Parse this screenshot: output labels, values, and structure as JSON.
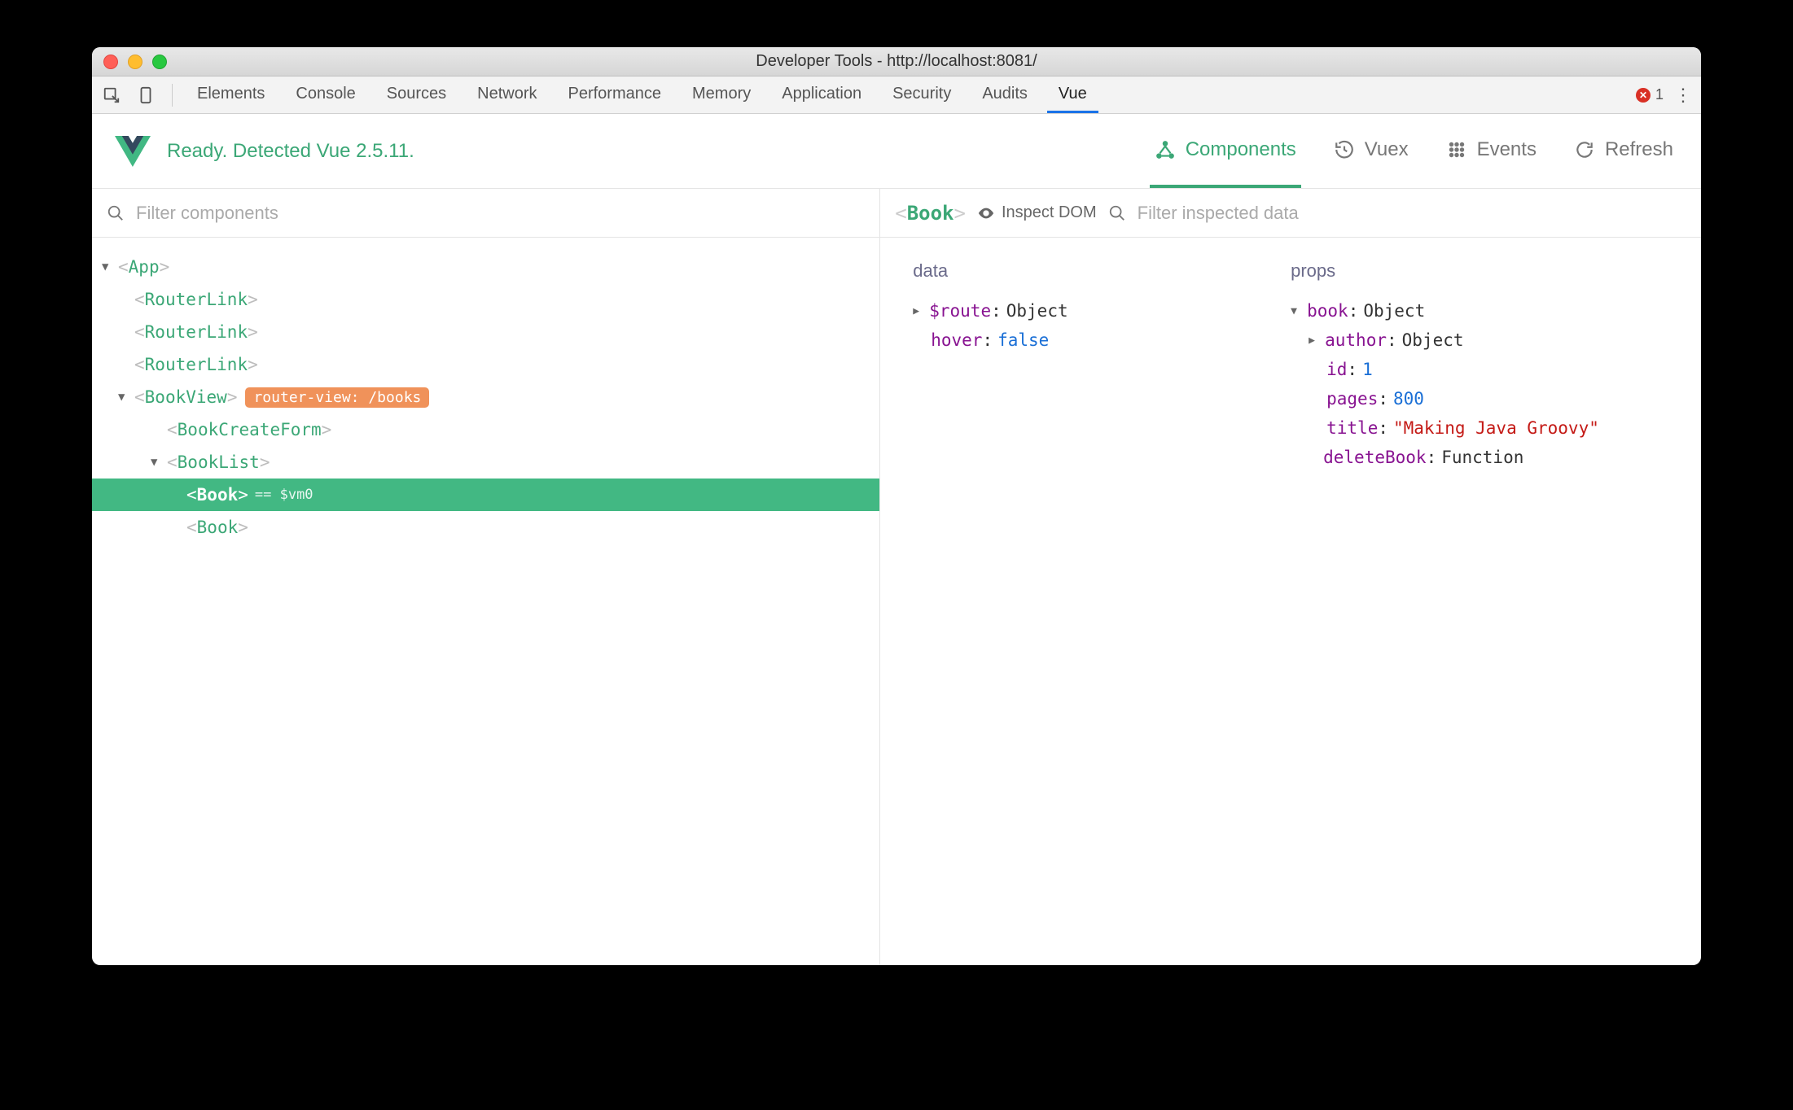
{
  "window": {
    "title": "Developer Tools - http://localhost:8081/"
  },
  "devtools": {
    "tabs": [
      "Elements",
      "Console",
      "Sources",
      "Network",
      "Performance",
      "Memory",
      "Application",
      "Security",
      "Audits",
      "Vue"
    ],
    "active_tab": "Vue",
    "error_count": "1"
  },
  "vuebar": {
    "status": "Ready. Detected Vue 2.5.11.",
    "tabs": {
      "components": "Components",
      "vuex": "Vuex",
      "events": "Events",
      "refresh": "Refresh"
    }
  },
  "filters": {
    "components_placeholder": "Filter components",
    "selected_component": "Book",
    "inspect_dom_label": "Inspect DOM",
    "inspected_placeholder": "Filter inspected data"
  },
  "tree": {
    "app": "App",
    "routerlink": "RouterLink",
    "bookview": "BookView",
    "bookview_badge": "router-view: /books",
    "bookcreateform": "BookCreateForm",
    "booklist": "BookList",
    "book": "Book",
    "vm_label": "== $vm0"
  },
  "inspector": {
    "data_title": "data",
    "props_title": "props",
    "data": {
      "route_key": "$route",
      "route_val": "Object",
      "hover_key": "hover",
      "hover_val": "false"
    },
    "props": {
      "book_key": "book",
      "book_val": "Object",
      "author_key": "author",
      "author_val": "Object",
      "id_key": "id",
      "id_val": "1",
      "pages_key": "pages",
      "pages_val": "800",
      "title_key": "title",
      "title_val": "\"Making Java Groovy\"",
      "deleteBook_key": "deleteBook",
      "deleteBook_val": "Function"
    }
  }
}
